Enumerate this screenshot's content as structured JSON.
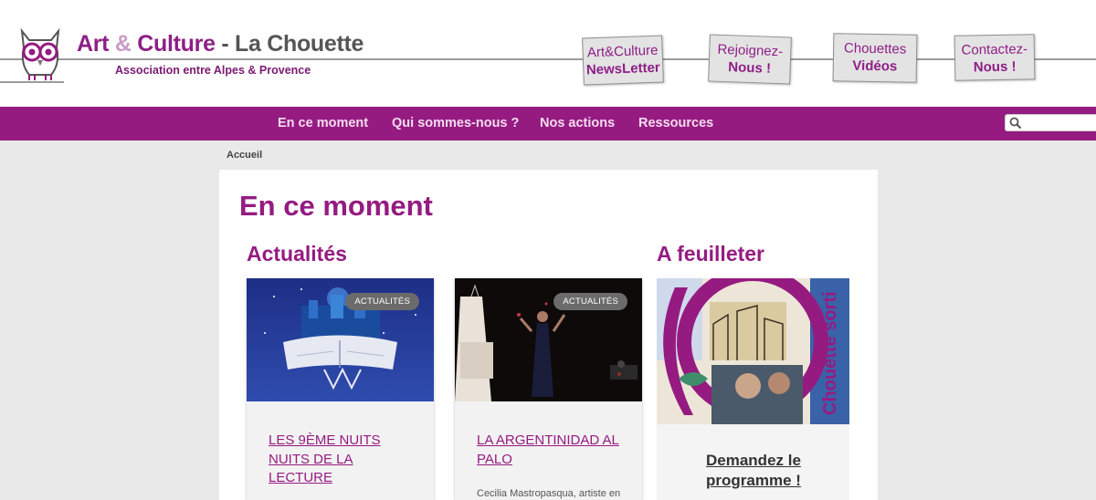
{
  "header": {
    "brand": {
      "part1": "Art ",
      "amp": "&",
      "part2": " Culture",
      "dash": " - ",
      "part3": "La Chouette"
    },
    "subtitle": "Association entre Alpes & Provence",
    "buttons": [
      {
        "line1": "Art&Culture",
        "line2": "NewsLetter"
      },
      {
        "line1": "Rejoignez-",
        "line2": "Nous !"
      },
      {
        "line1": "Chouettes",
        "line2": "Vidéos"
      },
      {
        "line1": "Contactez-",
        "line2": "Nous !"
      }
    ]
  },
  "nav": {
    "items": [
      "En ce moment",
      "Qui sommes-nous ?",
      "Nos actions",
      "Ressources"
    ],
    "search_placeholder": ""
  },
  "breadcrumb": "Accueil",
  "main": {
    "title": "En ce moment",
    "actualites_heading": "Actualités",
    "feuilleter_heading": "A feuilleter",
    "cards": [
      {
        "badge": "ACTUALITÉS",
        "title": "LES 9ÈME NUITS NUITS DE LA LECTURE",
        "excerpt": ""
      },
      {
        "badge": "ACTUALITÉS",
        "title": "LA ARGENTINIDAD AL PALO",
        "excerpt": "Cecilia Mastropasqua, artiste en"
      }
    ],
    "feuilleter_link": "Demandez le programme !"
  },
  "colors": {
    "brand": "#951b81",
    "nav_bg": "#951b81",
    "page_bg": "#e9e9e9"
  }
}
